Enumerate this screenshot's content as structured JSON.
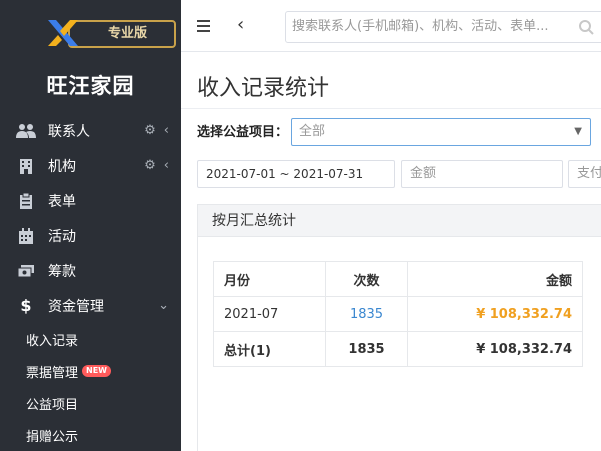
{
  "sidebar": {
    "badge": "专业版",
    "brand": "旺汪家园",
    "items": [
      {
        "label": "联系人",
        "icon": "users-icon",
        "gear": true
      },
      {
        "label": "机构",
        "icon": "building-icon",
        "gear": true
      },
      {
        "label": "表单",
        "icon": "clipboard-icon",
        "gear": false
      },
      {
        "label": "活动",
        "icon": "calendar-icon",
        "gear": false
      },
      {
        "label": "筹款",
        "icon": "money-icon",
        "gear": false
      },
      {
        "label": "资金管理",
        "icon": "dollar-icon",
        "gear": false
      }
    ],
    "sub_items": [
      "收入记录",
      "票据管理",
      "公益项目",
      "捐赠公示"
    ],
    "new_badge": "NEW"
  },
  "topbar": {
    "search_placeholder": "搜索联系人(手机邮箱)、机构、活动、表单..."
  },
  "page": {
    "title": "收入记录统计",
    "filter_label": "选择公益项目：",
    "select_value": "全部",
    "date_range": "2021-07-01 ~ 2021-07-31",
    "amount_placeholder": "金额",
    "pay_placeholder": "支付"
  },
  "panel": {
    "title": "按月汇总统计",
    "columns": [
      "月份",
      "次数",
      "金额"
    ],
    "rows": [
      {
        "month": "2021-07",
        "count": "1835",
        "amount": "¥ 108,332.74"
      }
    ],
    "total": {
      "month": "总计(1)",
      "count": "1835",
      "amount": "¥ 108,332.74"
    }
  },
  "colors": {
    "sidebar_bg": "#2b2f36",
    "accent": "#3a87d0",
    "amount": "#f0a020",
    "badge_border": "#c9a24a",
    "new_badge": "#ff5b5b"
  }
}
